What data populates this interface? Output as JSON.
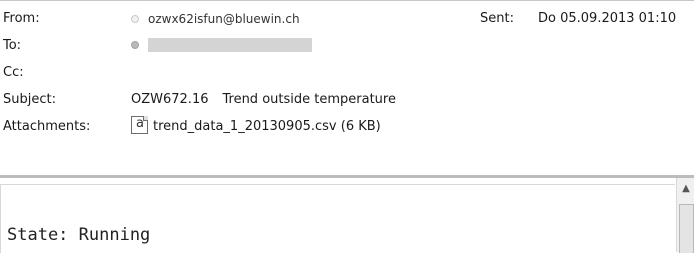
{
  "header": {
    "from": {
      "label": "From:",
      "value": "ozwx62isfun@bluewin.ch"
    },
    "sent": {
      "label": "Sent:",
      "value": "Do 05.09.2013 01:10"
    },
    "to": {
      "label": "To:"
    },
    "cc": {
      "label": "Cc:"
    },
    "subject": {
      "label": "Subject:",
      "device": "OZW672.16",
      "text": "Trend outside temperature"
    },
    "attachments": {
      "label": "Attachments:",
      "file_name": "trend_data_1_20130905.csv",
      "file_size": "(6 KB)"
    }
  },
  "icons": {
    "attachment": "csv-file-icon",
    "file_glyph": "a",
    "scroll_up": "scroll-up-arrow-icon",
    "scroll_up_glyph": "▲"
  },
  "body": {
    "text": "State: Running"
  }
}
